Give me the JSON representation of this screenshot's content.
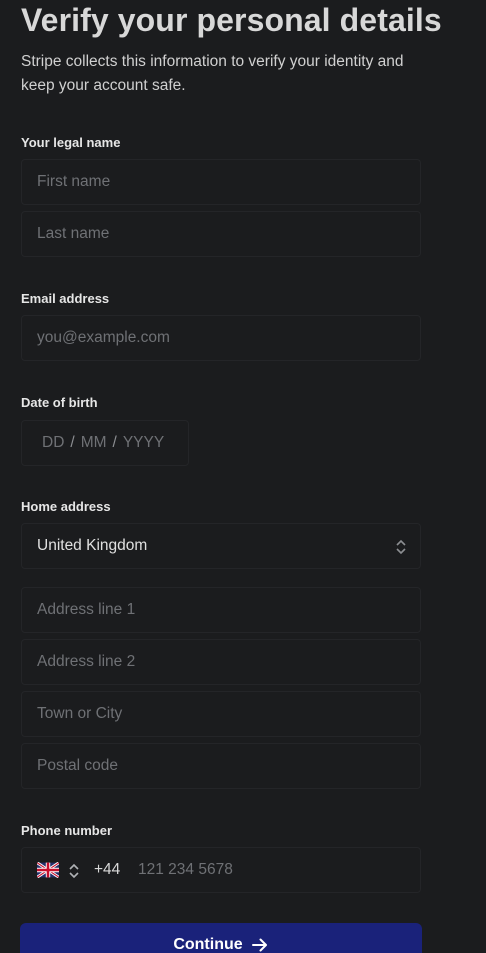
{
  "header": {
    "title": "Verify your personal details",
    "subtitle": "Stripe collects this information to verify your identity and keep your account safe."
  },
  "legal_name": {
    "label": "Your legal name",
    "first_placeholder": "First name",
    "last_placeholder": "Last name"
  },
  "email": {
    "label": "Email address",
    "placeholder": "you@example.com"
  },
  "dob": {
    "label": "Date of birth",
    "day": "DD",
    "month": "MM",
    "year": "YYYY",
    "separator": "/"
  },
  "address": {
    "label": "Home address",
    "country": "United Kingdom",
    "line1_placeholder": "Address line 1",
    "line2_placeholder": "Address line 2",
    "city_placeholder": "Town or City",
    "postal_placeholder": "Postal code"
  },
  "phone": {
    "label": "Phone number",
    "flag_icon": "uk-flag-icon",
    "code": "+44",
    "placeholder": "121 234 5678"
  },
  "actions": {
    "continue_label": "Continue",
    "continue_icon": "arrow-right-icon",
    "button_color": "#1a227a"
  }
}
